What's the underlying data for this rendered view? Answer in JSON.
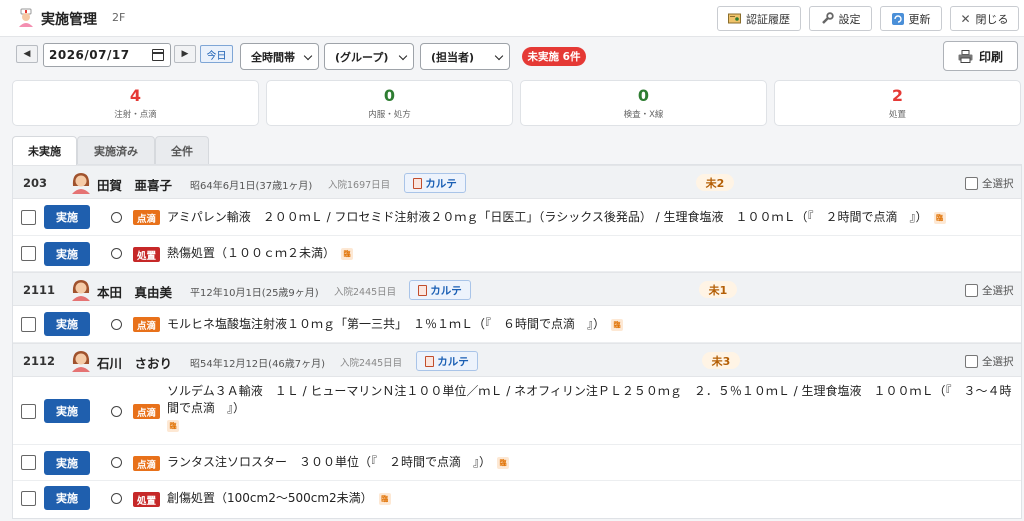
{
  "header": {
    "title": "実施管理",
    "floor": "2F",
    "buttons": {
      "auth_history": "認証履歴",
      "settings": "設定",
      "refresh": "更新",
      "close": "閉じる"
    }
  },
  "toolbar": {
    "prev": "◀",
    "next": "▶",
    "date": "2026/07/17",
    "today": "今日",
    "time_select": "全時間帯",
    "group_select": "(グループ)",
    "staff_select": "(担当者)",
    "pending_badge": "未実施 6件",
    "print": "印刷"
  },
  "summary": [
    {
      "count": "4",
      "label": "注射・点滴",
      "color": "#e53935"
    },
    {
      "count": "0",
      "label": "内服・処方",
      "color": "#2e7d32"
    },
    {
      "count": "0",
      "label": "検査・X線",
      "color": "#2e7d32"
    },
    {
      "count": "2",
      "label": "処置",
      "color": "#e53935"
    }
  ],
  "tabs": [
    "未実施",
    "実施済み",
    "全件"
  ],
  "labels": {
    "karte": "カルテ",
    "select_all": "全選択",
    "exec": "実施",
    "rin": "臨"
  },
  "colors": {
    "tenteki": "#e8711a",
    "shochi": "#c62828",
    "exec": "#1f5fae"
  },
  "patients": [
    {
      "room": "203",
      "name": "田賀　亜喜子",
      "birth": "昭64年6月1日(37歳1ヶ月)",
      "admit": "入院1697日目",
      "pending": "未2",
      "orders": [
        {
          "category": "点滴",
          "text": "アミパレン輸液　２００ｍＬ / フロセミド注射液２０ｍｇ「日医工」（ラシックス後発品） / 生理食塩液　１００ｍＬ（『　２時間で点滴　』）"
        },
        {
          "category": "処置",
          "text": "熱傷処置（１００ｃｍ２未満）"
        }
      ]
    },
    {
      "room": "2111",
      "name": "本田　真由美",
      "birth": "平12年10月1日(25歳9ヶ月)",
      "admit": "入院2445日目",
      "pending": "未1",
      "orders": [
        {
          "category": "点滴",
          "text": "モルヒネ塩酸塩注射液１０ｍｇ「第一三共」　１％１ｍＬ（『　６時間で点滴　』）"
        }
      ]
    },
    {
      "room": "2112",
      "name": "石川　さおり",
      "birth": "昭54年12月12日(46歳7ヶ月)",
      "admit": "入院2445日目",
      "pending": "未3",
      "orders": [
        {
          "category": "点滴",
          "text": "ソルデム３Ａ輸液　１Ｌ / ヒューマリンＮ注１００単位／ｍＬ / ネオフィリン注ＰＬ２５０ｍｇ　２．５％１０ｍＬ / 生理食塩液　１００ｍＬ（『　３〜４時間で点滴　』）"
        },
        {
          "category": "点滴",
          "text": "ランタス注ソロスター　３００単位（『　２時間で点滴　』）"
        },
        {
          "category": "処置",
          "text": "創傷処置（100cm2〜500cm2未満）"
        }
      ]
    }
  ]
}
